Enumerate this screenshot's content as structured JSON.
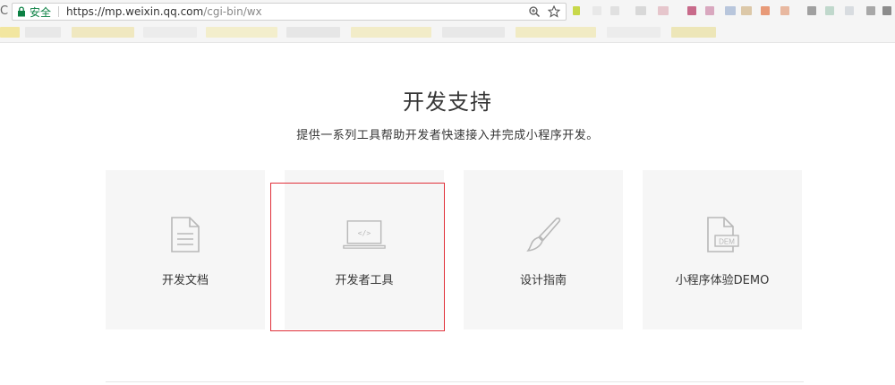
{
  "browser": {
    "nav_char": "C",
    "secure_label": "安全",
    "url_host": "https://mp.weixin.qq.com",
    "url_path": "/cgi-bin/wx"
  },
  "section": {
    "title": "开发支持",
    "subtitle": "提供一系列工具帮助开发者快速接入并完成小程序开发。"
  },
  "cards": [
    {
      "label": "开发文档",
      "icon": "document-icon"
    },
    {
      "label": "开发者工具",
      "icon": "laptop-code-icon",
      "highlighted": true
    },
    {
      "label": "设计指南",
      "icon": "paintbrush-icon"
    },
    {
      "label": "小程序体验DEMO",
      "icon": "demo-file-icon"
    }
  ],
  "colors": {
    "highlight_border": "#e0303a",
    "card_bg": "#f6f6f6",
    "icon_stroke": "#b8b8b8",
    "secure_green": "#0b8043"
  }
}
